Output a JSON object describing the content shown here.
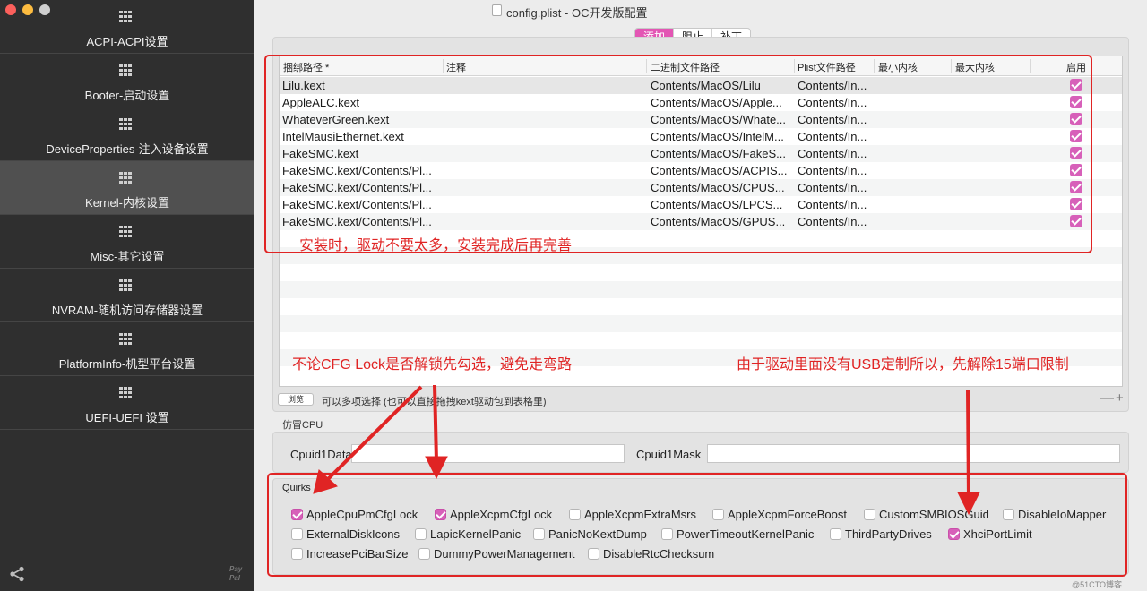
{
  "window": {
    "title": "config.plist - OC开发版配置"
  },
  "sidebar": {
    "items": [
      {
        "label": "ACPI-ACPI设置"
      },
      {
        "label": "Booter-启动设置"
      },
      {
        "label": "DeviceProperties-注入设备设置"
      },
      {
        "label": "Kernel-内核设置"
      },
      {
        "label": "Misc-其它设置"
      },
      {
        "label": "NVRAM-随机访问存储器设置"
      },
      {
        "label": "PlatformInfo-机型平台设置"
      },
      {
        "label": "UEFI-UEFI 设置"
      }
    ],
    "active_index": 3,
    "paypal_text": "Pay Pal"
  },
  "tabs": [
    {
      "label": "添加",
      "active": true
    },
    {
      "label": "阻止",
      "active": false
    },
    {
      "label": "补丁",
      "active": false
    }
  ],
  "table": {
    "columns": [
      "捆绑路径 *",
      "注释",
      "二进制文件路径",
      "Plist文件路径",
      "最小内核",
      "最大内核",
      "启用"
    ],
    "rows": [
      {
        "bundle": "Lilu.kext",
        "comment": "",
        "exec": "Contents/MacOS/Lilu",
        "plist": "Contents/In...",
        "min": "",
        "max": "",
        "enabled": true
      },
      {
        "bundle": "AppleALC.kext",
        "comment": "",
        "exec": "Contents/MacOS/Apple...",
        "plist": "Contents/In...",
        "min": "",
        "max": "",
        "enabled": true
      },
      {
        "bundle": "WhateverGreen.kext",
        "comment": "",
        "exec": "Contents/MacOS/Whate...",
        "plist": "Contents/In...",
        "min": "",
        "max": "",
        "enabled": true
      },
      {
        "bundle": "IntelMausiEthernet.kext",
        "comment": "",
        "exec": "Contents/MacOS/IntelM...",
        "plist": "Contents/In...",
        "min": "",
        "max": "",
        "enabled": true
      },
      {
        "bundle": "FakeSMC.kext",
        "comment": "",
        "exec": "Contents/MacOS/FakeS...",
        "plist": "Contents/In...",
        "min": "",
        "max": "",
        "enabled": true
      },
      {
        "bundle": "FakeSMC.kext/Contents/Pl...",
        "comment": "",
        "exec": "Contents/MacOS/ACPIS...",
        "plist": "Contents/In...",
        "min": "",
        "max": "",
        "enabled": true
      },
      {
        "bundle": "FakeSMC.kext/Contents/Pl...",
        "comment": "",
        "exec": "Contents/MacOS/CPUS...",
        "plist": "Contents/In...",
        "min": "",
        "max": "",
        "enabled": true
      },
      {
        "bundle": "FakeSMC.kext/Contents/Pl...",
        "comment": "",
        "exec": "Contents/MacOS/LPCS...",
        "plist": "Contents/In...",
        "min": "",
        "max": "",
        "enabled": true
      },
      {
        "bundle": "FakeSMC.kext/Contents/Pl...",
        "comment": "",
        "exec": "Contents/MacOS/GPUS...",
        "plist": "Contents/In...",
        "min": "",
        "max": "",
        "enabled": true
      }
    ]
  },
  "footer": {
    "browse_label": "浏览",
    "hint": "可以多项选择 (也可以直接拖拽kext驱动包到表格里)",
    "plus_minus": "—+"
  },
  "cpu": {
    "section_title": "仿冒CPU",
    "data_label": "Cpuid1Data",
    "data_value": "",
    "mask_label": "Cpuid1Mask",
    "mask_value": ""
  },
  "quirks": {
    "title": "Quirks",
    "items": [
      {
        "label": "AppleCpuPmCfgLock",
        "checked": true
      },
      {
        "label": "AppleXcpmCfgLock",
        "checked": true
      },
      {
        "label": "AppleXcpmExtraMsrs",
        "checked": false
      },
      {
        "label": "AppleXcpmForceBoost",
        "checked": false
      },
      {
        "label": "CustomSMBIOSGuid",
        "checked": false
      },
      {
        "label": "DisableIoMapper",
        "checked": false
      },
      {
        "label": "ExternalDiskIcons",
        "checked": false
      },
      {
        "label": "LapicKernelPanic",
        "checked": false
      },
      {
        "label": "PanicNoKextDump",
        "checked": false
      },
      {
        "label": "PowerTimeoutKernelPanic",
        "checked": false
      },
      {
        "label": "ThirdPartyDrives",
        "checked": false
      },
      {
        "label": "XhciPortLimit",
        "checked": true
      },
      {
        "label": "IncreasePciBarSize",
        "checked": false
      },
      {
        "label": "DummyPowerManagement",
        "checked": false
      },
      {
        "label": "DisableRtcChecksum",
        "checked": false
      }
    ]
  },
  "annotations": {
    "note_table": "安装时，驱动不要太多，安装完成后再完善",
    "note_cfg": "不论CFG Lock是否解锁先勾选，避免走弯路",
    "note_usb": "由于驱动里面没有USB定制所以，先解除15端口限制",
    "color": "#e02424"
  },
  "watermark": "@51CTO博客",
  "colors": {
    "accent": "#e356b4",
    "checkbox": "#d760b9",
    "sidebar_bg": "#2f2f2f"
  }
}
